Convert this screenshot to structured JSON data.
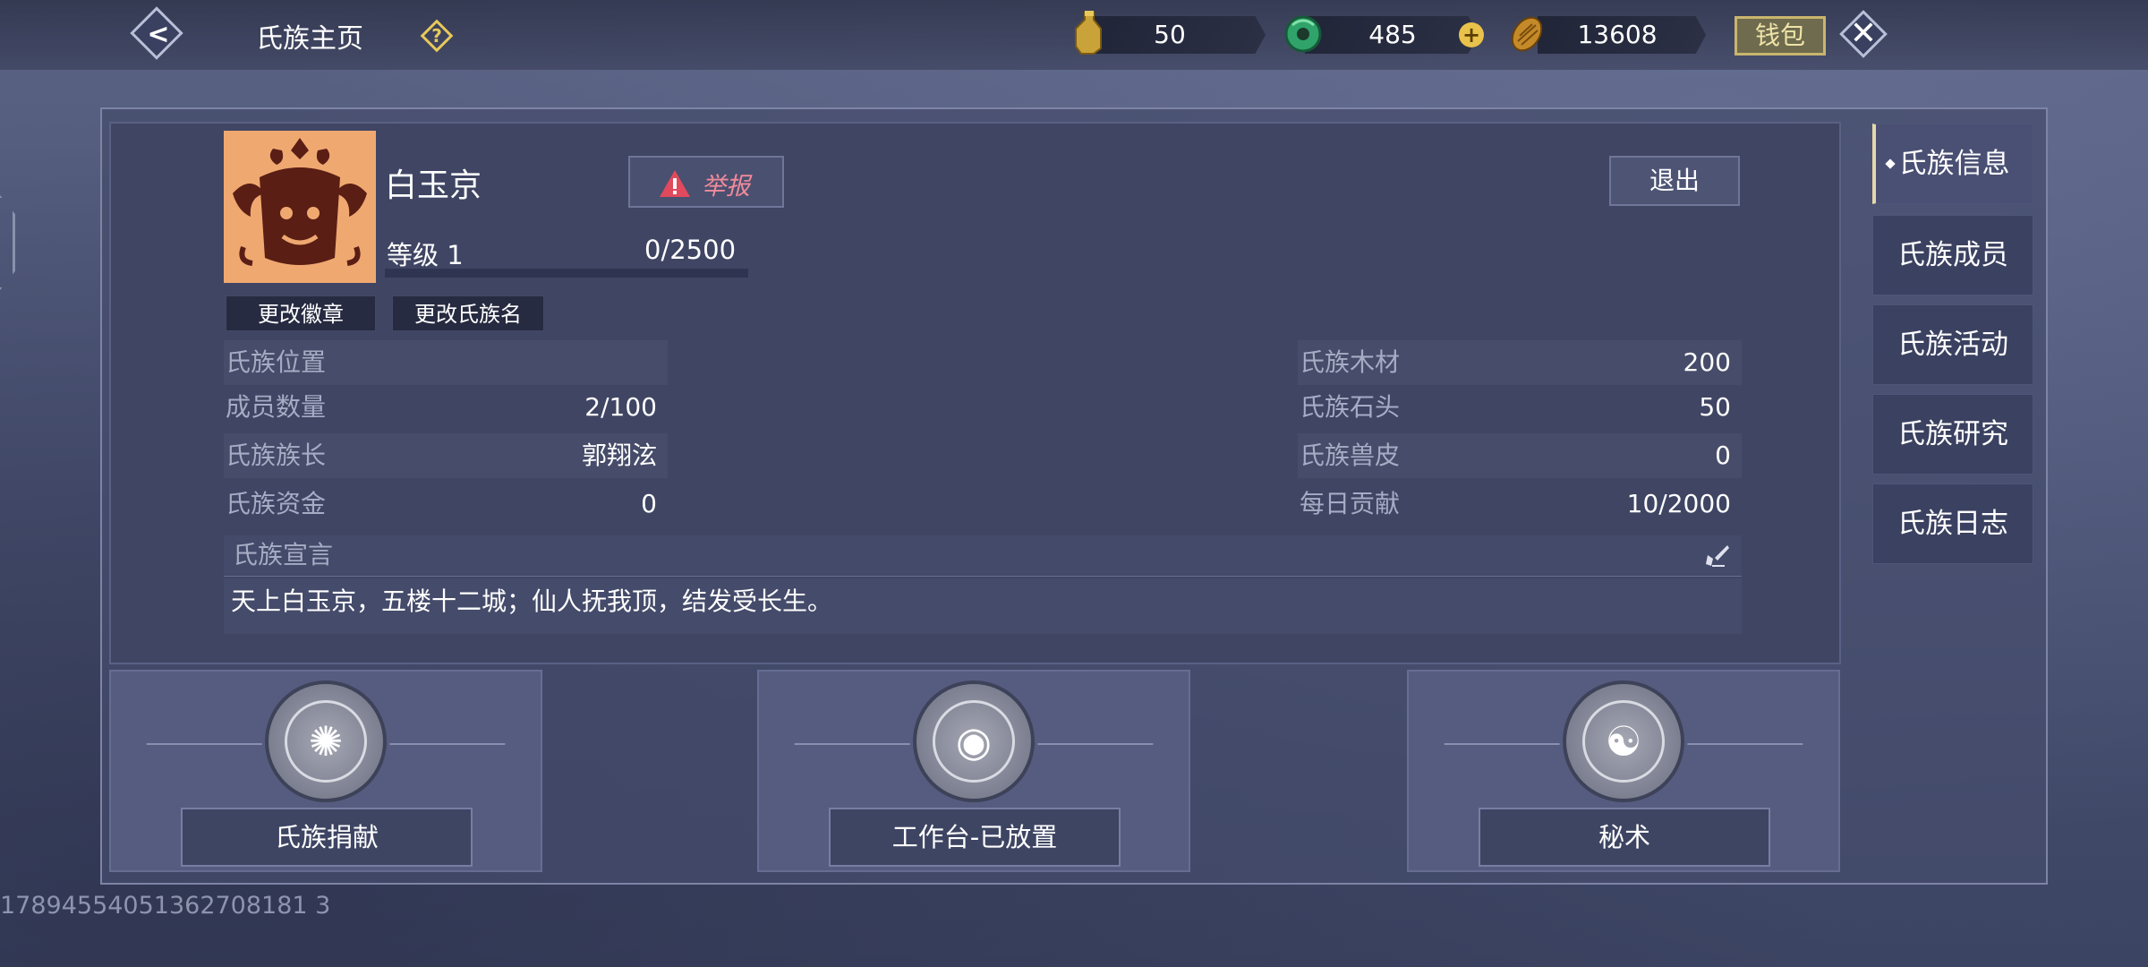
{
  "header": {
    "title": "氏族主页",
    "help_glyph": "?",
    "back_glyph": "<",
    "close_glyph": "✕"
  },
  "currencies": [
    {
      "icon": "gold-bottle-icon",
      "value": "50"
    },
    {
      "icon": "jade-coin-icon",
      "value": "485"
    },
    {
      "icon": "gold-shell-icon",
      "value": "13608"
    }
  ],
  "wallet_label": "钱包",
  "clan": {
    "name": "白玉京",
    "report_label": "举报",
    "exit_label": "退出",
    "level_label": "等级 1",
    "exp_text": "0/2500",
    "exp_fraction": 0,
    "change_emblem_label": "更改徽章",
    "change_name_label": "更改氏族名"
  },
  "stats_left": [
    {
      "label": "氏族位置",
      "value": ""
    },
    {
      "label": "成员数量",
      "value": "2/100"
    },
    {
      "label": "氏族族长",
      "value": "郭翔泫"
    },
    {
      "label": "氏族资金",
      "value": "0"
    }
  ],
  "stats_right": [
    {
      "label": "氏族木材",
      "value": "200"
    },
    {
      "label": "氏族石头",
      "value": "50"
    },
    {
      "label": "氏族兽皮",
      "value": "0"
    },
    {
      "label": "每日贡献",
      "value": "10/2000"
    }
  ],
  "declaration": {
    "label": "氏族宣言",
    "text": "天上白玉京，五楼十二城；仙人抚我顶，结发受长生。"
  },
  "cards": [
    {
      "label": "氏族捐献",
      "icon": "swirl-emblem-icon",
      "glyph": "✺"
    },
    {
      "label": "工作台-已放置",
      "icon": "eye-emblem-icon",
      "glyph": "◉"
    },
    {
      "label": "秘术",
      "icon": "wave-emblem-icon",
      "glyph": "☯"
    }
  ],
  "tabs": [
    {
      "label": "氏族信息",
      "active": true
    },
    {
      "label": "氏族成员",
      "active": false
    },
    {
      "label": "氏族活动",
      "active": false
    },
    {
      "label": "氏族研究",
      "active": false
    },
    {
      "label": "氏族日志",
      "active": false
    }
  ],
  "footer_id": "17894554051362708181 3",
  "colors": {
    "accent_gold": "#e8c85a",
    "report_red": "#f08a9a",
    "emblem_bg": "#f0a871",
    "panel": "#3f4563"
  }
}
